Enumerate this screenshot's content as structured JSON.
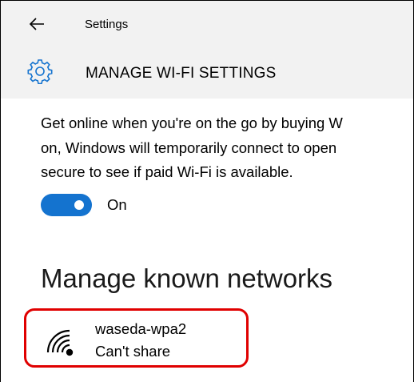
{
  "window": {
    "title": "Settings",
    "back_icon": "arrow-left-icon"
  },
  "page": {
    "title": "MANAGE WI-FI SETTINGS",
    "icon": "gear-icon",
    "icon_color": "#1473cf"
  },
  "paid_wifi": {
    "description_lines": [
      "Get online when you're on the go by buying W",
      "on, Windows will temporarily connect to open",
      "secure to see if paid Wi-Fi is available."
    ],
    "toggle_state": "On",
    "toggle_on": true,
    "toggle_color": "#1473cf"
  },
  "known_networks": {
    "title": "Manage known networks",
    "items": [
      {
        "name": "waseda-wpa2",
        "status": "Can't share",
        "icon": "wifi-signal-icon"
      }
    ],
    "highlight_color": "#e00000"
  }
}
